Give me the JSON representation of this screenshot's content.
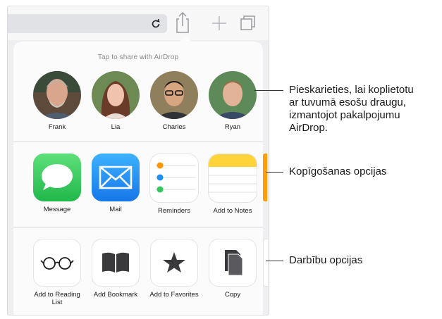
{
  "airdrop": {
    "title": "Tap to share with AirDrop",
    "people": [
      {
        "name": "Frank"
      },
      {
        "name": "Lia"
      },
      {
        "name": "Charles"
      },
      {
        "name": "Ryan"
      }
    ]
  },
  "apps": [
    {
      "label": "Message",
      "icon": "message-icon",
      "color": "#34c759"
    },
    {
      "label": "Mail",
      "icon": "mail-icon",
      "color": "#1f8ef1"
    },
    {
      "label": "Reminders",
      "icon": "reminders-icon",
      "color": "#ffffff"
    },
    {
      "label": "Add to Notes",
      "icon": "notes-icon",
      "color": "#ffd43b"
    }
  ],
  "actions": [
    {
      "label": "Add to Reading\nList",
      "icon": "glasses-icon"
    },
    {
      "label": "Add Bookmark",
      "icon": "book-icon"
    },
    {
      "label": "Add to Favorites",
      "icon": "star-icon"
    },
    {
      "label": "Copy",
      "icon": "copy-icon"
    }
  ],
  "callouts": {
    "airdrop": "Pieskarieties, lai koplietotu\nar tuvumā esošu draugu,\nizmantojot pakalpojumu\nAirDrop.",
    "share": "Kopīgošanas opcijas",
    "actions": "Darbību opcijas"
  }
}
